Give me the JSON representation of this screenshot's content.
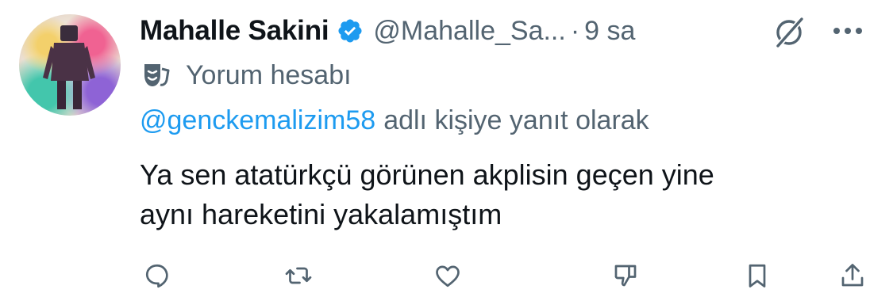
{
  "tweet": {
    "author": {
      "display_name": "Mahalle Sakini",
      "handle": "@Mahalle_Sa...",
      "verified": true
    },
    "separator": "·",
    "time": "9 sa",
    "account_label": {
      "icon": "theater-mask-icon",
      "text": "Yorum hesabı"
    },
    "reply_to": {
      "mention": "@genckemalizim58",
      "suffix": "adlı kişiye yanıt olarak"
    },
    "text": "Ya sen atatürkçü görünen akplisin geçen yine\naynı hareketini yakalamıştım",
    "actions": [
      {
        "name": "reply-button",
        "icon": "reply-bubble-icon"
      },
      {
        "name": "retweet-button",
        "icon": "retweet-icon"
      },
      {
        "name": "like-button",
        "icon": "heart-icon"
      },
      {
        "name": "dislike-button",
        "icon": "thumbs-down-icon"
      },
      {
        "name": "bookmark-button",
        "icon": "bookmark-icon"
      },
      {
        "name": "share-button",
        "icon": "share-icon"
      }
    ]
  },
  "colors": {
    "text_primary": "#0f1419",
    "text_secondary": "#536471",
    "link": "#1d9bf0",
    "verified_badge": "#1d9bf0"
  }
}
